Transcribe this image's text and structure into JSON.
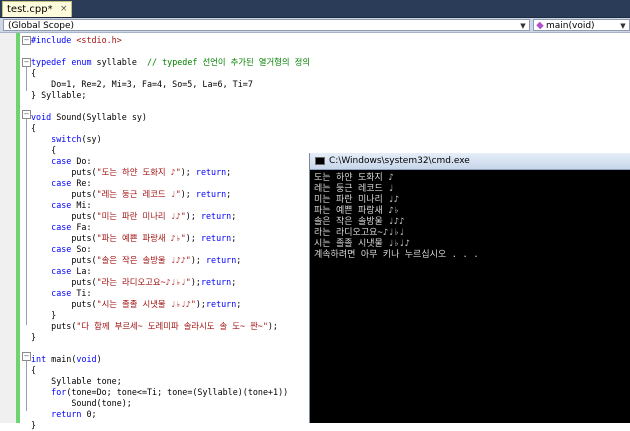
{
  "tab": {
    "label": "test.cpp*",
    "close": "×"
  },
  "scope": {
    "left": "(Global Scope)",
    "right": "main(void)"
  },
  "code": [
    [
      {
        "c": "k",
        "t": "#include"
      },
      {
        "c": "n",
        "t": " "
      },
      {
        "c": "s",
        "t": "<stdio.h>"
      }
    ],
    [],
    [
      {
        "c": "k",
        "t": "typedef"
      },
      {
        "c": "n",
        "t": " "
      },
      {
        "c": "k",
        "t": "enum"
      },
      {
        "c": "n",
        "t": " syllable  "
      },
      {
        "c": "c",
        "t": "// typedef 선언이 추가된 열거형의 정의"
      }
    ],
    [
      {
        "c": "n",
        "t": "{"
      }
    ],
    [
      {
        "c": "n",
        "t": "    Do=1, Re=2, Mi=3, Fa=4, So=5, La=6, Ti=7"
      }
    ],
    [
      {
        "c": "n",
        "t": "} Syllable;"
      }
    ],
    [],
    [
      {
        "c": "k",
        "t": "void"
      },
      {
        "c": "n",
        "t": " Sound(Syllable sy)"
      }
    ],
    [
      {
        "c": "n",
        "t": "{"
      }
    ],
    [
      {
        "c": "n",
        "t": "    "
      },
      {
        "c": "k",
        "t": "switch"
      },
      {
        "c": "n",
        "t": "(sy)"
      }
    ],
    [
      {
        "c": "n",
        "t": "    {"
      }
    ],
    [
      {
        "c": "n",
        "t": "    "
      },
      {
        "c": "k",
        "t": "case"
      },
      {
        "c": "n",
        "t": " Do:"
      }
    ],
    [
      {
        "c": "n",
        "t": "        puts("
      },
      {
        "c": "s",
        "t": "\"도는 하얀 도화지 ♪\""
      },
      {
        "c": "n",
        "t": "); "
      },
      {
        "c": "k",
        "t": "return"
      },
      {
        "c": "n",
        "t": ";"
      }
    ],
    [
      {
        "c": "n",
        "t": "    "
      },
      {
        "c": "k",
        "t": "case"
      },
      {
        "c": "n",
        "t": " Re:"
      }
    ],
    [
      {
        "c": "n",
        "t": "        puts("
      },
      {
        "c": "s",
        "t": "\"레는 둥근 레코드 ♩\""
      },
      {
        "c": "n",
        "t": "); "
      },
      {
        "c": "k",
        "t": "return"
      },
      {
        "c": "n",
        "t": ";"
      }
    ],
    [
      {
        "c": "n",
        "t": "    "
      },
      {
        "c": "k",
        "t": "case"
      },
      {
        "c": "n",
        "t": " Mi:"
      }
    ],
    [
      {
        "c": "n",
        "t": "        puts("
      },
      {
        "c": "s",
        "t": "\"미는 파란 미나리 ♩♪\""
      },
      {
        "c": "n",
        "t": "); "
      },
      {
        "c": "k",
        "t": "return"
      },
      {
        "c": "n",
        "t": ";"
      }
    ],
    [
      {
        "c": "n",
        "t": "    "
      },
      {
        "c": "k",
        "t": "case"
      },
      {
        "c": "n",
        "t": " Fa:"
      }
    ],
    [
      {
        "c": "n",
        "t": "        puts("
      },
      {
        "c": "s",
        "t": "\"파는 예쁜 파랑새 ♪♭\""
      },
      {
        "c": "n",
        "t": "); "
      },
      {
        "c": "k",
        "t": "return"
      },
      {
        "c": "n",
        "t": ";"
      }
    ],
    [
      {
        "c": "n",
        "t": "    "
      },
      {
        "c": "k",
        "t": "case"
      },
      {
        "c": "n",
        "t": " So:"
      }
    ],
    [
      {
        "c": "n",
        "t": "        puts("
      },
      {
        "c": "s",
        "t": "\"솔은 작은 솔방울 ♩♪♪\""
      },
      {
        "c": "n",
        "t": "); "
      },
      {
        "c": "k",
        "t": "return"
      },
      {
        "c": "n",
        "t": ";"
      }
    ],
    [
      {
        "c": "n",
        "t": "    "
      },
      {
        "c": "k",
        "t": "case"
      },
      {
        "c": "n",
        "t": " La:"
      }
    ],
    [
      {
        "c": "n",
        "t": "        puts("
      },
      {
        "c": "s",
        "t": "\"라는 라디오고요~♪♩♭♩\""
      },
      {
        "c": "n",
        "t": ");"
      },
      {
        "c": "k",
        "t": "return"
      },
      {
        "c": "n",
        "t": ";"
      }
    ],
    [
      {
        "c": "n",
        "t": "    "
      },
      {
        "c": "k",
        "t": "case"
      },
      {
        "c": "n",
        "t": " Ti:"
      }
    ],
    [
      {
        "c": "n",
        "t": "        puts("
      },
      {
        "c": "s",
        "t": "\"시는 졸졸 시냇물 ♩♭♩♪\""
      },
      {
        "c": "n",
        "t": ");"
      },
      {
        "c": "k",
        "t": "return"
      },
      {
        "c": "n",
        "t": ";"
      }
    ],
    [
      {
        "c": "n",
        "t": "    }"
      }
    ],
    [
      {
        "c": "n",
        "t": "    puts("
      },
      {
        "c": "s",
        "t": "\"다 함께 부르세~ 도레미파 솔라시도 솔 도~ 짠~\""
      },
      {
        "c": "n",
        "t": ");"
      }
    ],
    [
      {
        "c": "n",
        "t": "}"
      }
    ],
    [],
    [
      {
        "c": "k",
        "t": "int"
      },
      {
        "c": "n",
        "t": " main("
      },
      {
        "c": "k",
        "t": "void"
      },
      {
        "c": "n",
        "t": ")"
      }
    ],
    [
      {
        "c": "n",
        "t": "{"
      }
    ],
    [
      {
        "c": "n",
        "t": "    Syllable tone;"
      }
    ],
    [
      {
        "c": "n",
        "t": "    "
      },
      {
        "c": "k",
        "t": "for"
      },
      {
        "c": "n",
        "t": "(tone=Do; tone<=Ti; tone=(Syllable)(tone+1))"
      }
    ],
    [
      {
        "c": "n",
        "t": "        Sound(tone);"
      }
    ],
    [
      {
        "c": "n",
        "t": "    "
      },
      {
        "c": "k",
        "t": "return"
      },
      {
        "c": "n",
        "t": " 0;"
      }
    ],
    [
      {
        "c": "n",
        "t": "}"
      }
    ]
  ],
  "console": {
    "title": "C:\\Windows\\system32\\cmd.exe",
    "lines": [
      "도는 하얀 도화지 ♪",
      "레는 둥근 레코드 ♩",
      "미는 파란 미나리 ♩♪",
      "파는 예쁜 파랑새 ♪♭",
      "솔은 작은 솔방울 ♩♪♪",
      "라는 라디오고요~♪♩♭♩",
      "시는 졸졸 시냇물 ♩♭♩♪",
      "계속하려면 아무 키나 누르십시오 . . ."
    ]
  }
}
